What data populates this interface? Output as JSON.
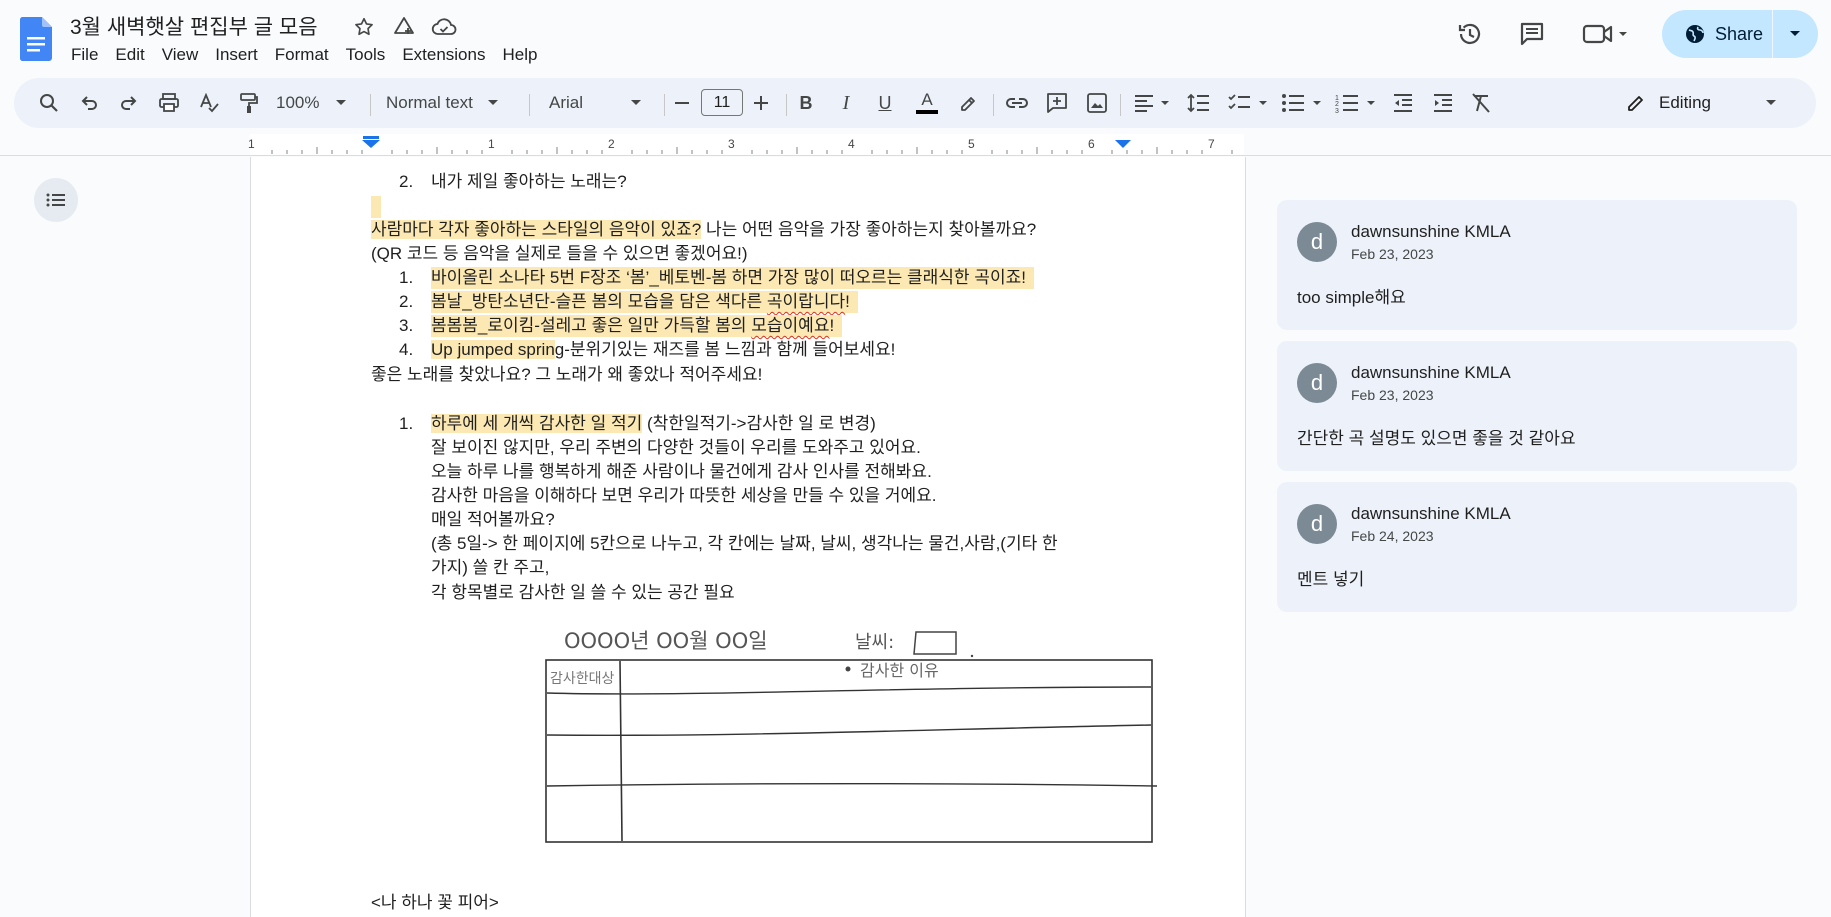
{
  "app": {
    "doc_title": "3월 새벽햇살 편집부 글 모음",
    "menu": [
      "File",
      "Edit",
      "View",
      "Insert",
      "Format",
      "Tools",
      "Extensions",
      "Help"
    ],
    "share_label": "Share",
    "accent_color": "#0b57d0",
    "share_bg": "#c2e7ff"
  },
  "toolbar": {
    "zoom": "100%",
    "style": "Normal text",
    "font": "Arial",
    "font_size": "11",
    "mode": "Editing"
  },
  "ruler": {
    "labels": [
      "1",
      "1",
      "2",
      "3",
      "4",
      "5",
      "6",
      "7"
    ]
  },
  "document": {
    "lines": [
      {
        "num": "2.",
        "text": "내가 제일 좋아하는 노래는?"
      },
      {
        "num": "",
        "text": "사람마다 각자 좋아하는 스타일의 음악이 있죠?",
        "tail": " 나는 어떤 음악을 가장 좋아하는지 찾아볼까요?"
      },
      {
        "num": "",
        "text": "(QR 코드 등 음악을 실제로 들을 수 있으면 좋겠어요!)"
      },
      {
        "num": "1.",
        "text": "바이올린 소나타 5번 F장조 ‘봄’_베토벤-봄 하면 가장 많이 떠오르는 클래식한 곡이죠!"
      },
      {
        "num": "2.",
        "text": "봄날_방탄소년단-슬픈 봄의 모습을 담은 색다른 ",
        "squiggle": "곡이랍니다",
        "after": "!"
      },
      {
        "num": "3.",
        "text": "봄봄봄_로이킴-설레고 좋은 일만 가득할 봄의 ",
        "squiggle": "모습이예요",
        "after": "!"
      },
      {
        "num": "4.",
        "text": "Up jumped sprin",
        "tail": "g-분위기있는 재즈를 봄 느낌과 함께 들어보세요!"
      },
      {
        "num": "",
        "text": "좋은 노래를 찾았나요? 그 노래가 왜 좋았나 적어주세요!"
      },
      {
        "num": "1.",
        "text": "하루에 세 개씩 감사한 일 적기",
        "tail": " (착한일적기->감사한 일 로 변경)"
      },
      {
        "num": "",
        "text": "잘 보이진 않지만, 우리 주변의 다양한 것들이 우리를 도와주고 있어요."
      },
      {
        "num": "",
        "text": "오늘 하루 나를 행복하게 해준 사람이나 물건에게 감사 인사를 전해봐요."
      },
      {
        "num": "",
        "text": "감사한 마음을 이해하다 보면 우리가 따뜻한 세상을 만들 수 있을 거에요."
      },
      {
        "num": "",
        "text": "매일 적어볼까요?"
      },
      {
        "num": "",
        "text": "(총 5일-> 한 페이지에 5칸으로 나누고, 각 칸에는 날짜, 날씨, 생각나는 물건,사람,(기타 한"
      },
      {
        "num": "",
        "text": "가지) 쓸 칸 주고,"
      },
      {
        "num": "",
        "text": "각 항목별로 감사한 일 쓸 수 있는 공간 필요"
      },
      {
        "num": "",
        "text": "<나 하나 꽃 피어>"
      }
    ],
    "sketch": {
      "header": "OOOO년 OO월 OO일",
      "weather": "날씨:",
      "col1": "감사한대상",
      "col2": "감사한 이유"
    }
  },
  "comments": [
    {
      "author": "dawnsunshine KMLA",
      "date": "Feb 23, 2023",
      "text": "too simple해요",
      "initial": "d"
    },
    {
      "author": "dawnsunshine KMLA",
      "date": "Feb 23, 2023",
      "text": "간단한 곡 설명도 있으면 좋을 것 같아요",
      "initial": "d"
    },
    {
      "author": "dawnsunshine KMLA",
      "date": "Feb 24, 2023",
      "text": "멘트 넣기",
      "initial": "d"
    }
  ]
}
